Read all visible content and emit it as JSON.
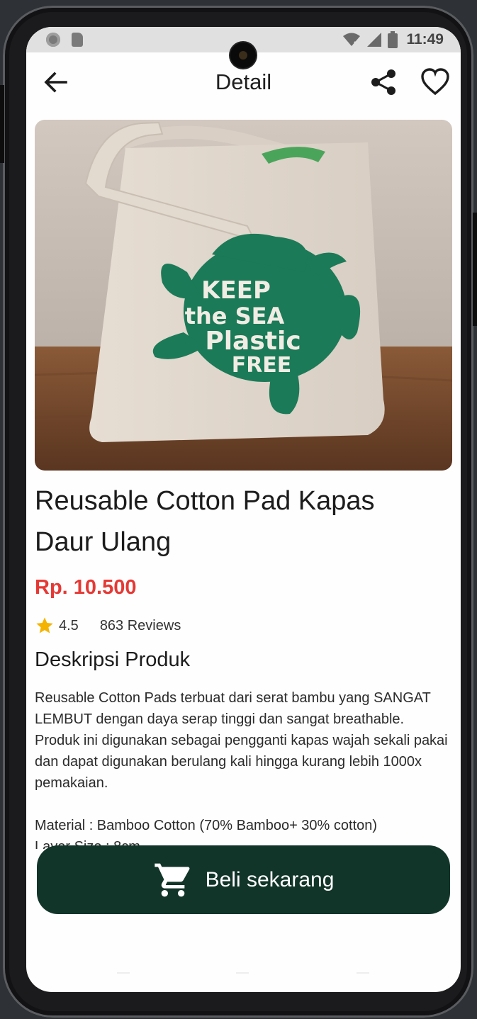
{
  "status_bar": {
    "time": "11:49"
  },
  "app_bar": {
    "title": "Detail",
    "icons": [
      "back-arrow-icon",
      "share-icon",
      "heart-outline-icon"
    ]
  },
  "product": {
    "name": "Reusable Cotton Pad Kapas Daur Ulang",
    "price": "Rp. 10.500",
    "rating": "4.5",
    "reviews": "863 Reviews",
    "image_print": {
      "line1": "KEEP",
      "line2": "the SEA",
      "line3": "Plastic",
      "line4": "FREE"
    }
  },
  "description": {
    "title": "Deskripsi Produk",
    "text": "Reusable Cotton Pads terbuat dari serat bambu yang SANGAT LEMBUT dengan daya serap tinggi dan sangat breathable. Produk ini digunakan sebagai pengganti kapas wajah sekali pakai dan dapat digunakan berulang kali hingga kurang lebih 1000x pemakaian.\n\nMaterial : Bamboo Cotton (70% Bamboo+ 30% cotton)\nLayer Size : 8cm"
  },
  "buy_button": {
    "label": "Beli sekarang",
    "icon": "cart-icon"
  },
  "colors": {
    "price": "#e53935",
    "button_bg": "#12352a",
    "star": "#f5b301",
    "print": "#1b7a58"
  }
}
